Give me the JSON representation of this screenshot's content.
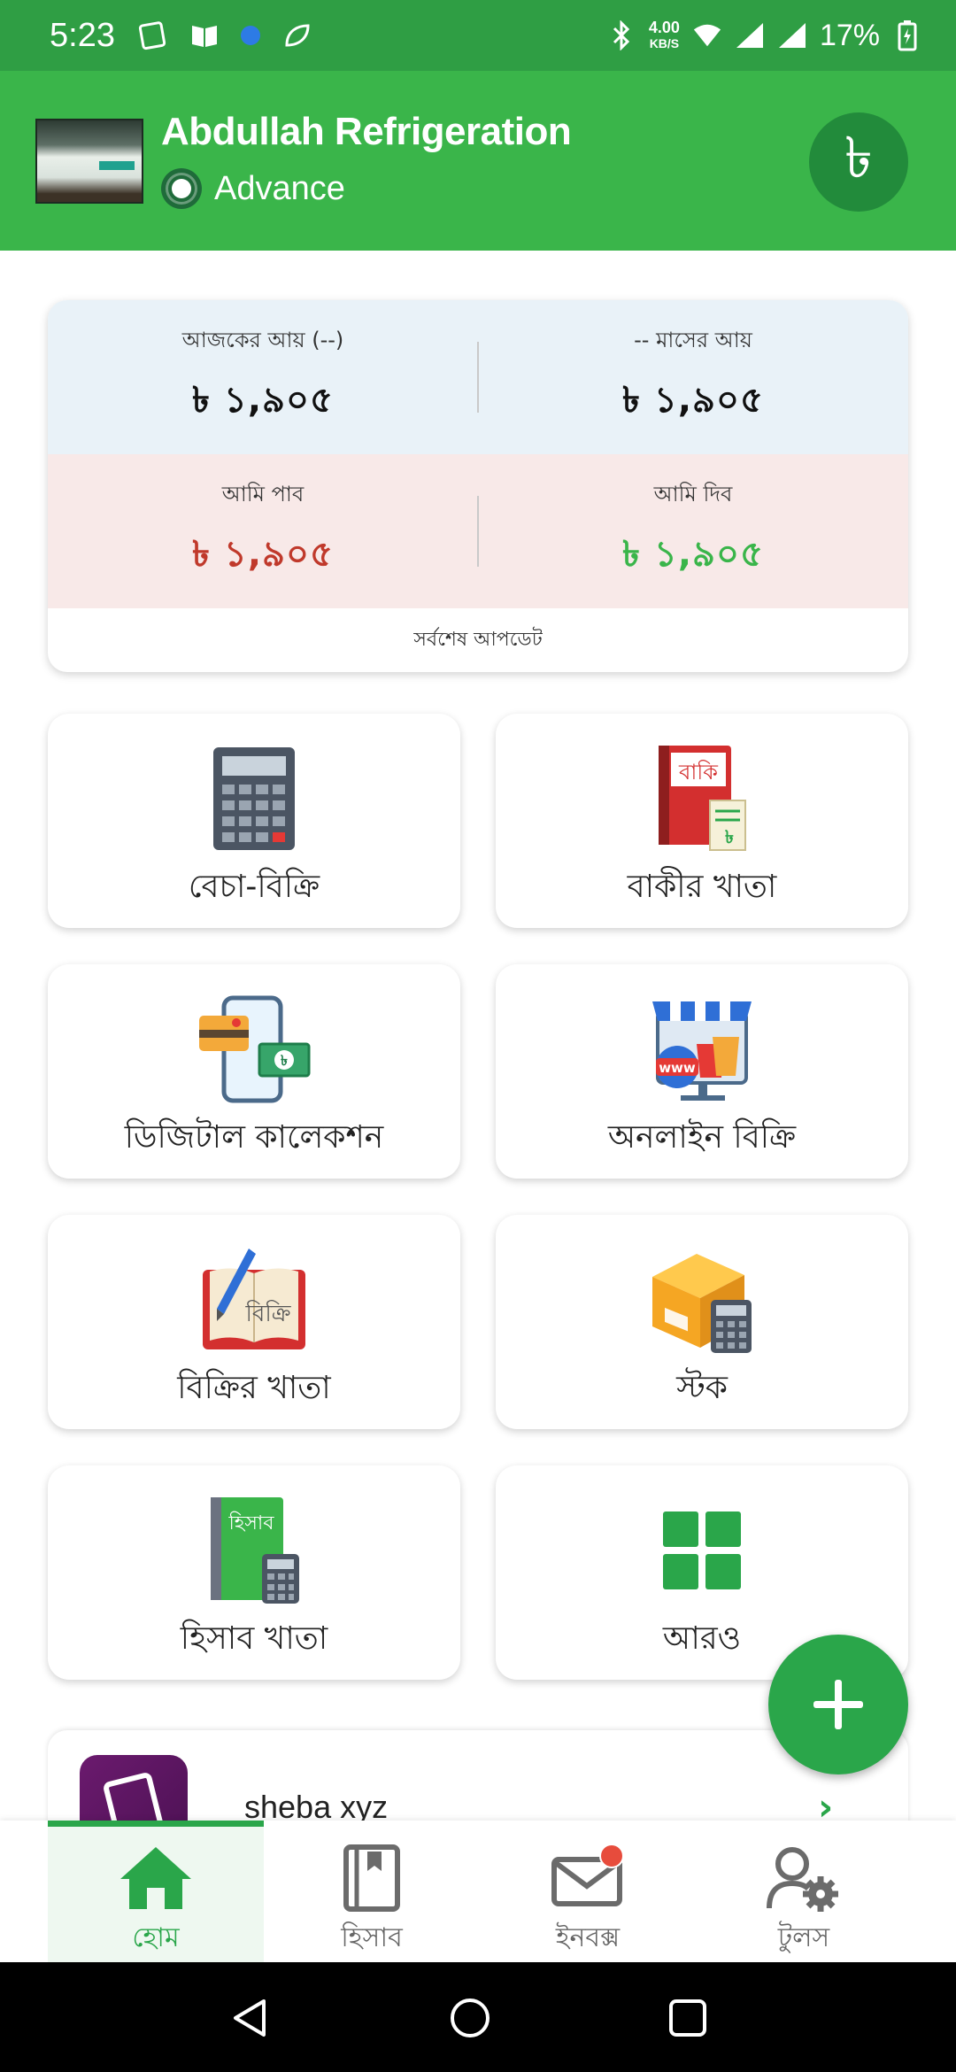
{
  "status_bar": {
    "time": "5:23",
    "speed": "4.00",
    "speed_unit": "KB/S",
    "battery": "17%"
  },
  "header": {
    "business_name": "Abdullah Refrigeration",
    "plan": "Advance",
    "currency_icon": "taka-icon",
    "taka_symbol": "৳"
  },
  "summary": {
    "today_income_label": "আজকের আয় (--)",
    "today_income_value": "৳ ১,৯০৫",
    "month_income_label": "-- মাসের আয়",
    "month_income_value": "৳ ১,৯০৫",
    "receivable_label": "আমি পাব",
    "receivable_value": "৳ ১,৯০৫",
    "payable_label": "আমি দিব",
    "payable_value": "৳ ১,৯০৫",
    "last_update": "সর্বশেষ আপডেট",
    "colors": {
      "receivable": "#c0392b",
      "payable": "#3ab54a"
    }
  },
  "tiles": [
    {
      "label": "বেচা-বিক্রি",
      "icon": "calculator-icon"
    },
    {
      "label": "বাকীর খাতা",
      "icon": "due-book-icon",
      "icon_text": "বাকি"
    },
    {
      "label": "ডিজিটাল কালেকশন",
      "icon": "digital-payment-icon"
    },
    {
      "label": "অনলাইন বিক্রি",
      "icon": "online-shop-icon",
      "icon_text": "www"
    },
    {
      "label": "বিক্রির খাতা",
      "icon": "sales-book-icon",
      "icon_text": "বিক্রি"
    },
    {
      "label": "স্টক",
      "icon": "stock-box-icon"
    },
    {
      "label": "হিসাব খাতা",
      "icon": "accounts-book-icon",
      "icon_text": "হিসাব"
    },
    {
      "label": "আরও",
      "icon": "grid-more-icon"
    }
  ],
  "promo": {
    "title": "sheba xyz"
  },
  "bottom_nav": [
    {
      "label": "হোম",
      "icon": "home-icon",
      "active": true
    },
    {
      "label": "হিসাব",
      "icon": "ledger-icon",
      "active": false
    },
    {
      "label": "ইনবক্স",
      "icon": "inbox-icon",
      "active": false
    },
    {
      "label": "টুলস",
      "icon": "tools-icon",
      "active": false
    }
  ],
  "colors": {
    "primary": "#3ab54a",
    "status_bar": "#2f9e44",
    "accent_dark": "#228b3b"
  }
}
